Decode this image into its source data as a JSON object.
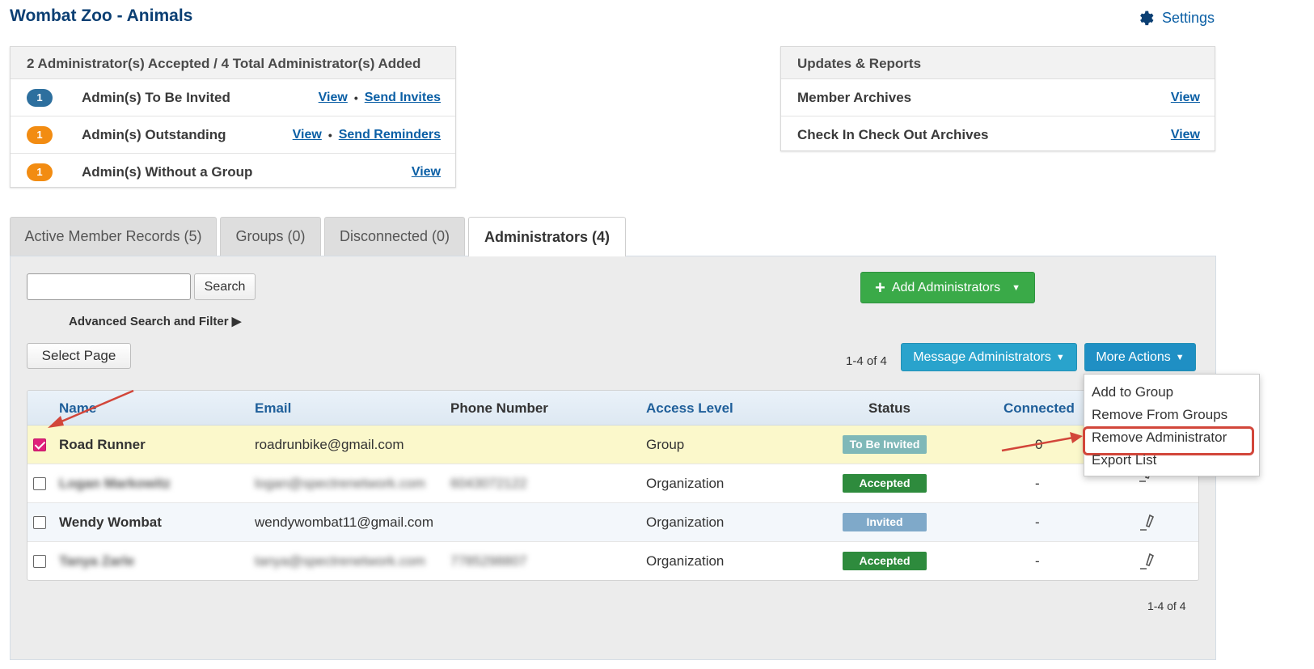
{
  "page_title": "Wombat Zoo - Animals",
  "settings_label": "Settings",
  "admin_panel": {
    "title": "2 Administrator(s) Accepted / 4 Total Administrator(s) Added",
    "rows": [
      {
        "count": "1",
        "label": "Admin(s) To Be Invited",
        "link1": "View",
        "link2": "Send Invites",
        "color": "#2d6f9e"
      },
      {
        "count": "1",
        "label": "Admin(s) Outstanding",
        "link1": "View",
        "link2": "Send Reminders",
        "color": "#f28c12"
      },
      {
        "count": "1",
        "label": "Admin(s) Without a Group",
        "link1": "View",
        "color": "#f28c12"
      }
    ]
  },
  "reports_panel": {
    "title": "Updates & Reports",
    "rows": [
      {
        "label": "Member Archives",
        "link": "View"
      },
      {
        "label": "Check In Check Out Archives",
        "link": "View"
      }
    ]
  },
  "tabs": [
    {
      "label": "Active Member Records (5)"
    },
    {
      "label": "Groups (0)"
    },
    {
      "label": "Disconnected (0)"
    },
    {
      "label": "Administrators (4)",
      "active": true
    }
  ],
  "search": {
    "value": "",
    "button": "Search",
    "advanced": "Advanced Search and Filter ▶"
  },
  "add_admins_button": "Add Administrators",
  "select_page_button": "Select Page",
  "pagination_top": "1-4 of 4",
  "message_admins_button": "Message Administrators",
  "more_actions_button": "More Actions",
  "more_actions_menu": [
    "Add to Group",
    "Remove From Groups",
    "Remove Administrator",
    "Export List"
  ],
  "table": {
    "headers": [
      "Name",
      "Email",
      "Phone Number",
      "Access Level",
      "Status",
      "Connected"
    ],
    "rows": [
      {
        "checked": true,
        "name": "Road Runner",
        "email": "roadrunbike@gmail.com",
        "phone": "",
        "access": "Group",
        "status": "To Be Invited",
        "connected": "0"
      },
      {
        "checked": false,
        "name": "Logan Markowitz",
        "email": "logan@spectrenetwork.com",
        "phone": "6043072122",
        "access": "Organization",
        "status": "Accepted",
        "connected": "-"
      },
      {
        "checked": false,
        "name": "Wendy Wombat",
        "email": "wendywombat11@gmail.com",
        "phone": "",
        "access": "Organization",
        "status": "Invited",
        "connected": "-"
      },
      {
        "checked": false,
        "name": "Tanya Zarle",
        "email": "tanya@spectrenetwork.com",
        "phone": "7785298807",
        "access": "Organization",
        "status": "Accepted",
        "connected": "-"
      }
    ]
  },
  "pagination_bottom": "1-4 of 4",
  "colors": {
    "title": "#0b3f73",
    "link": "#0b5fa5",
    "green": "#3aaa48",
    "blue": "#29a3cc",
    "accepted": "#2e8b3d",
    "invited": "#7fa9c9",
    "to_be_invited": "#7fb8b8",
    "annotation": "#d2463a"
  }
}
